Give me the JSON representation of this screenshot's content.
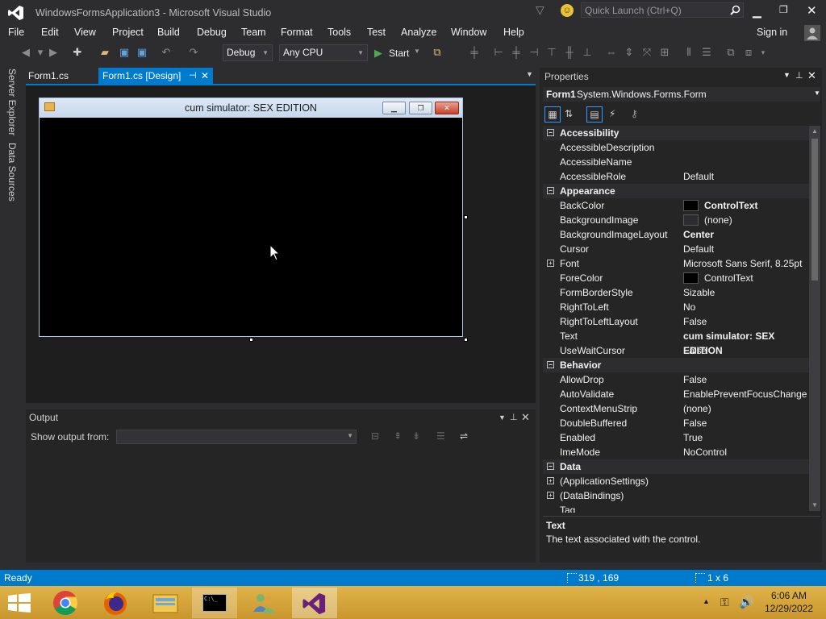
{
  "window": {
    "title": "WindowsFormsApplication3 - Microsoft Visual Studio"
  },
  "quick_launch": {
    "placeholder": "Quick Launch (Ctrl+Q)"
  },
  "menu": [
    "File",
    "Edit",
    "View",
    "Project",
    "Build",
    "Debug",
    "Team",
    "Format",
    "Tools",
    "Test",
    "Analyze",
    "Window",
    "Help"
  ],
  "signin": "Sign in",
  "toolbar": {
    "config": "Debug",
    "platform": "Any CPU",
    "start": "Start"
  },
  "sidetabs": [
    "Server Explorer",
    "Data Sources"
  ],
  "doctabs": [
    {
      "label": "Form1.cs"
    },
    {
      "label": "Form1.cs [Design]"
    }
  ],
  "form": {
    "title": "cum simulator: SEX EDITION"
  },
  "output": {
    "title": "Output",
    "show_from": "Show output from:"
  },
  "properties": {
    "title": "Properties",
    "object_name": "Form1",
    "object_type": "System.Windows.Forms.Form",
    "categories": [
      {
        "name": "Accessibility",
        "rows": [
          {
            "name": "AccessibleDescription",
            "value": ""
          },
          {
            "name": "AccessibleName",
            "value": ""
          },
          {
            "name": "AccessibleRole",
            "value": "Default"
          }
        ]
      },
      {
        "name": "Appearance",
        "rows": [
          {
            "name": "BackColor",
            "value": "ControlText",
            "bold": true,
            "swatch": "#000000"
          },
          {
            "name": "BackgroundImage",
            "value": "(none)",
            "swatch": "#2d2d30"
          },
          {
            "name": "BackgroundImageLayout",
            "value": "Center",
            "bold": true
          },
          {
            "name": "Cursor",
            "value": "Default"
          },
          {
            "name": "Font",
            "value": "Microsoft Sans Serif, 8.25pt",
            "expand": true
          },
          {
            "name": "ForeColor",
            "value": "ControlText",
            "swatch": "#000000"
          },
          {
            "name": "FormBorderStyle",
            "value": "Sizable"
          },
          {
            "name": "RightToLeft",
            "value": "No"
          },
          {
            "name": "RightToLeftLayout",
            "value": "False"
          },
          {
            "name": "Text",
            "value": "cum simulator: SEX EDITION",
            "bold": true
          },
          {
            "name": "UseWaitCursor",
            "value": "False"
          }
        ]
      },
      {
        "name": "Behavior",
        "rows": [
          {
            "name": "AllowDrop",
            "value": "False"
          },
          {
            "name": "AutoValidate",
            "value": "EnablePreventFocusChange"
          },
          {
            "name": "ContextMenuStrip",
            "value": "(none)"
          },
          {
            "name": "DoubleBuffered",
            "value": "False"
          },
          {
            "name": "Enabled",
            "value": "True"
          },
          {
            "name": "ImeMode",
            "value": "NoControl"
          }
        ]
      },
      {
        "name": "Data",
        "rows": [
          {
            "name": "(ApplicationSettings)",
            "value": "",
            "expand": true
          },
          {
            "name": "(DataBindings)",
            "value": "",
            "expand": true
          },
          {
            "name": "Tag",
            "value": ""
          }
        ]
      }
    ],
    "desc_title": "Text",
    "desc_text": "The text associated with the control."
  },
  "status": {
    "text": "Ready",
    "position": "319 , 169",
    "size": "1 x 6"
  },
  "clock": {
    "time": "6:06 AM",
    "date": "12/29/2022"
  },
  "colors": {
    "accent": "#007acc",
    "vs_purple": "#68217a"
  }
}
